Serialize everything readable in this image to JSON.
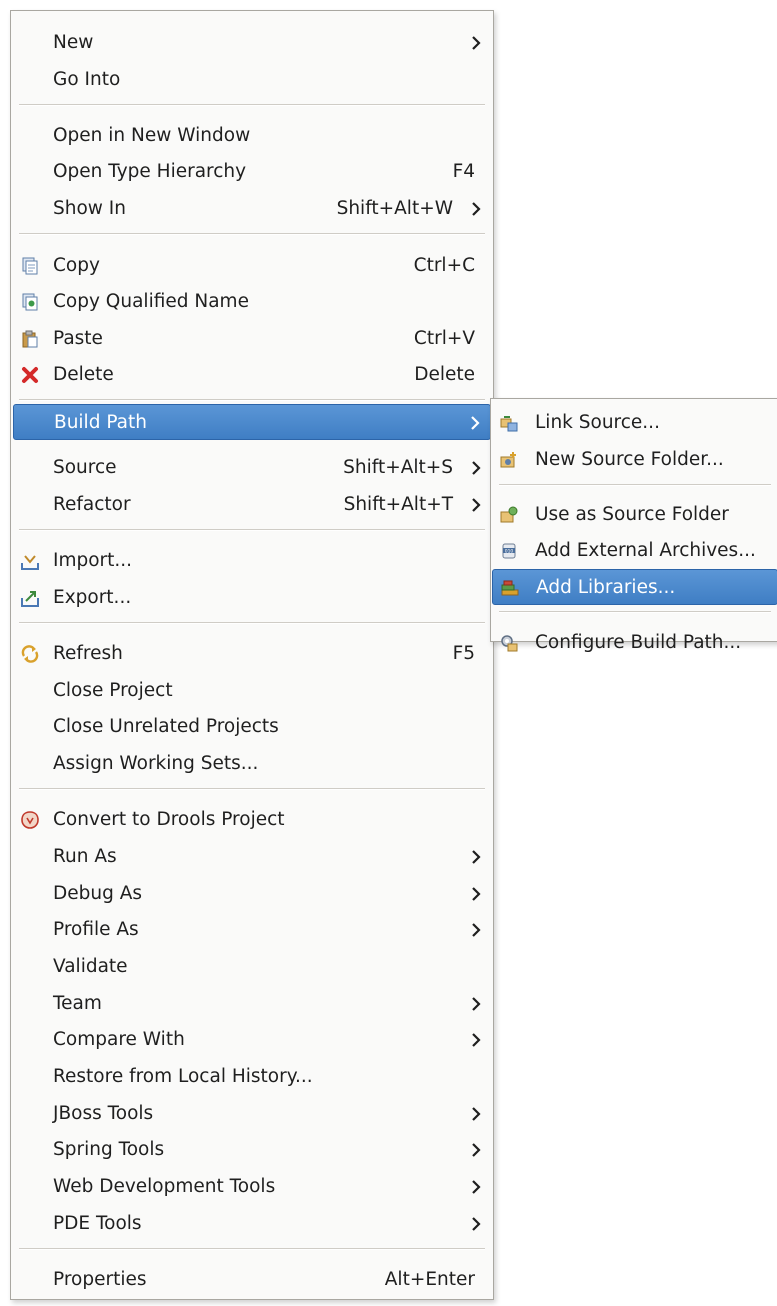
{
  "context_menu": {
    "items": {
      "new": {
        "label": "New",
        "submenu": true
      },
      "go_into": {
        "label": "Go Into"
      },
      "open_in_new_window": {
        "label": "Open in New Window"
      },
      "open_type_hierarchy": {
        "label": "Open Type Hierarchy",
        "shortcut": "F4"
      },
      "show_in": {
        "label": "Show In",
        "shortcut": "Shift+Alt+W",
        "submenu": true
      },
      "copy": {
        "label": "Copy",
        "shortcut": "Ctrl+C",
        "icon": "copy-icon"
      },
      "copy_qualified_name": {
        "label": "Copy Qualified Name",
        "icon": "copy-qualified-name-icon"
      },
      "paste": {
        "label": "Paste",
        "shortcut": "Ctrl+V",
        "icon": "paste-icon"
      },
      "delete": {
        "label": "Delete",
        "shortcut": "Delete",
        "icon": "delete-icon"
      },
      "build_path": {
        "label": "Build Path",
        "submenu": true,
        "highlighted": true
      },
      "source": {
        "label": "Source",
        "shortcut": "Shift+Alt+S",
        "submenu": true
      },
      "refactor": {
        "label": "Refactor",
        "shortcut": "Shift+Alt+T",
        "submenu": true
      },
      "import": {
        "label": "Import...",
        "icon": "import-icon"
      },
      "export": {
        "label": "Export...",
        "icon": "export-icon"
      },
      "refresh": {
        "label": "Refresh",
        "shortcut": "F5",
        "icon": "refresh-icon"
      },
      "close_project": {
        "label": "Close Project"
      },
      "close_unrelated_projects": {
        "label": "Close Unrelated Projects"
      },
      "assign_working_sets": {
        "label": "Assign Working Sets..."
      },
      "convert_to_drools_project": {
        "label": "Convert to Drools Project",
        "icon": "drools-icon"
      },
      "run_as": {
        "label": "Run As",
        "submenu": true
      },
      "debug_as": {
        "label": "Debug As",
        "submenu": true
      },
      "profile_as": {
        "label": "Profile As",
        "submenu": true
      },
      "validate": {
        "label": "Validate"
      },
      "team": {
        "label": "Team",
        "submenu": true
      },
      "compare_with": {
        "label": "Compare With",
        "submenu": true
      },
      "restore_from_local_history": {
        "label": "Restore from Local History..."
      },
      "jboss_tools": {
        "label": "JBoss Tools",
        "submenu": true
      },
      "spring_tools": {
        "label": "Spring Tools",
        "submenu": true
      },
      "web_development_tools": {
        "label": "Web Development Tools",
        "submenu": true
      },
      "pde_tools": {
        "label": "PDE Tools",
        "submenu": true
      },
      "properties": {
        "label": "Properties",
        "shortcut": "Alt+Enter"
      }
    }
  },
  "build_path_submenu": {
    "items": {
      "link_source": {
        "label": "Link Source...",
        "icon": "link-source-icon"
      },
      "new_source_folder": {
        "label": "New Source Folder...",
        "icon": "new-source-folder-icon"
      },
      "use_as_source_folder": {
        "label": "Use as Source Folder",
        "icon": "use-as-source-folder-icon"
      },
      "add_external_archives": {
        "label": "Add External Archives...",
        "icon": "add-external-archives-icon"
      },
      "add_libraries": {
        "label": "Add Libraries...",
        "icon": "add-libraries-icon",
        "highlighted": true
      },
      "configure_build_path": {
        "label": "Configure Build Path...",
        "icon": "configure-build-path-icon"
      }
    }
  },
  "colors": {
    "highlight": "#4a89cf",
    "menu_background": "#fafaf9",
    "delete_icon": "#d42a2a"
  }
}
